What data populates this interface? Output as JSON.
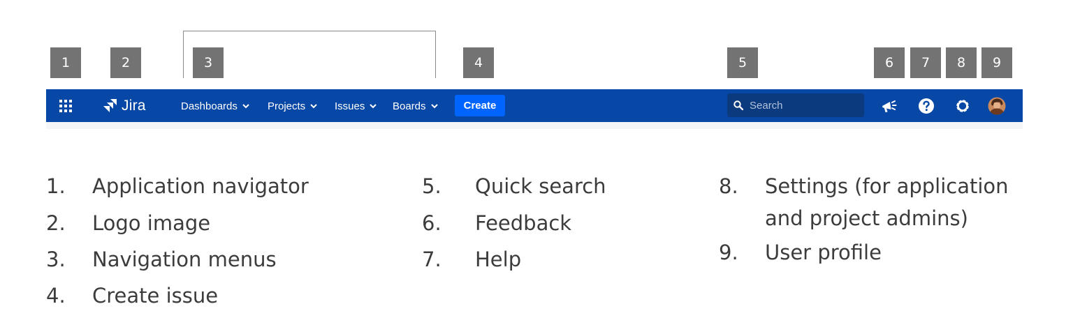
{
  "badges": [
    "1",
    "2",
    "3",
    "4",
    "5",
    "6",
    "7",
    "8",
    "9"
  ],
  "navbar": {
    "logo_text": "Jira",
    "menus": [
      {
        "label": "Dashboards"
      },
      {
        "label": "Projects"
      },
      {
        "label": "Issues"
      },
      {
        "label": "Boards"
      }
    ],
    "create_label": "Create",
    "search": {
      "placeholder": "Search"
    },
    "colors": {
      "bar": "#0747a6",
      "create": "#0065ff",
      "search_bg": "#0c3a7e"
    },
    "icons": [
      "app-grid-icon",
      "jira-logo-icon",
      "chevron-down-icon",
      "search-icon",
      "megaphone-icon",
      "help-icon",
      "gear-icon",
      "user-avatar-icon"
    ]
  },
  "legend": [
    {
      "num": "1.",
      "text": "Application navigator"
    },
    {
      "num": "2.",
      "text": "Logo image"
    },
    {
      "num": "3.",
      "text": "Navigation menus"
    },
    {
      "num": "4.",
      "text": "Create issue"
    },
    {
      "num": "5.",
      "text": "Quick search"
    },
    {
      "num": "6.",
      "text": "Feedback"
    },
    {
      "num": "7.",
      "text": "Help"
    },
    {
      "num": "8.",
      "text": "Settings (for application",
      "text2": "and project admins)"
    },
    {
      "num": "9.",
      "text": "User profile"
    }
  ]
}
